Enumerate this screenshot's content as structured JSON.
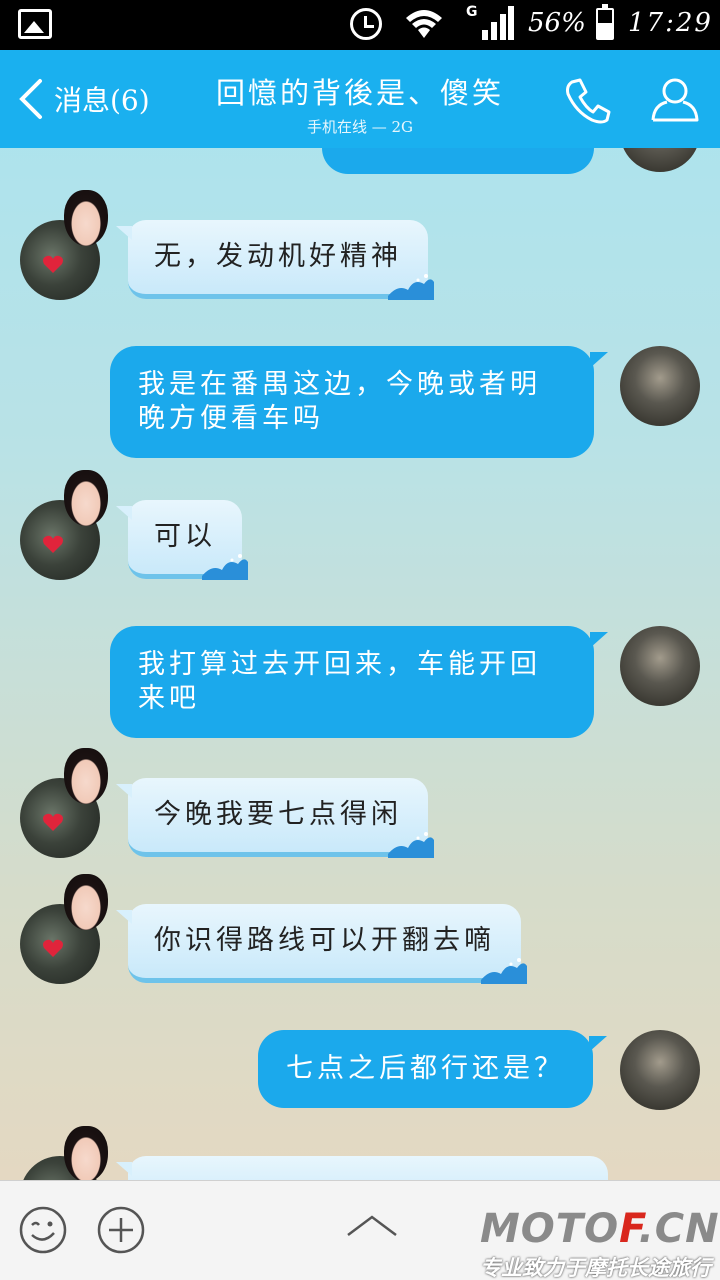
{
  "status_bar": {
    "battery_percent": "56%",
    "time": "17:29",
    "network": "G"
  },
  "header": {
    "back_label": "消息(6)",
    "contact_name": "回憶的背後是、傻笑",
    "contact_status": "手机在线 — 2G"
  },
  "messages": [
    {
      "side": "in",
      "text": "无，发动机好精神"
    },
    {
      "side": "out",
      "text": "我是在番禺这边，今晚或者明晚方便看车吗"
    },
    {
      "side": "in",
      "text": "可以"
    },
    {
      "side": "out",
      "text": "我打算过去开回来，车能开回来吧"
    },
    {
      "side": "in",
      "text": "今晚我要七点得闲"
    },
    {
      "side": "in",
      "text": "你识得路线可以开翻去嘀"
    },
    {
      "side": "out",
      "text": "七点之后都行还是？"
    }
  ],
  "watermark": {
    "brand_left": "MOTO",
    "brand_mid": "F",
    "brand_right": ".CN",
    "slogan": "专业致力于摩托长途旅行"
  },
  "colors": {
    "header": "#1ab0ef",
    "outgoing_bubble": "#1ba9ec",
    "incoming_bubble": "#d8f0fc"
  }
}
